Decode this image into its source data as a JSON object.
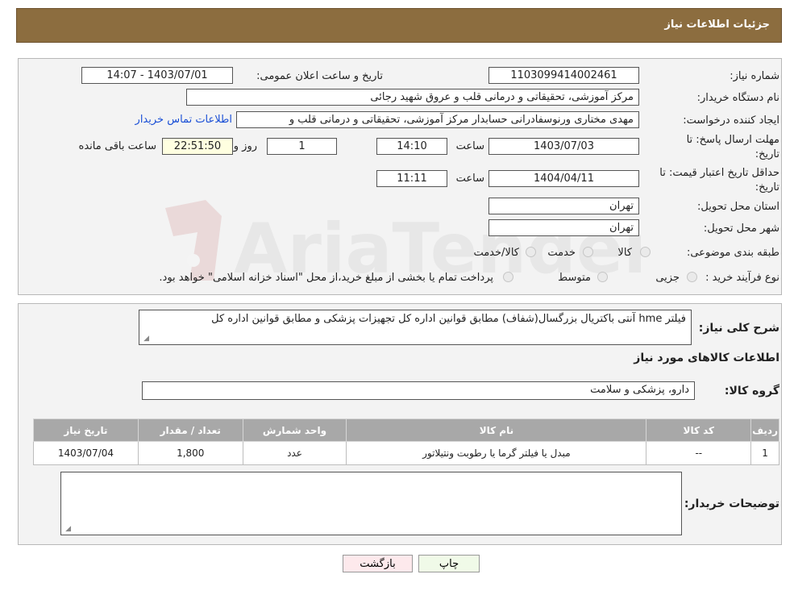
{
  "header": {
    "title": "جزئیات اطلاعات نیاز"
  },
  "need": {
    "number_label": "شماره نیاز:",
    "number_value": "1103099414002461",
    "announce_label": "تاریخ و ساعت اعلان عمومی:",
    "announce_value": "1403/07/01 - 14:07",
    "buyer_label": "نام دستگاه خریدار:",
    "buyer_value": "مرکز آموزشی، تحقیقاتی و درمانی قلب و عروق شهید رجائی",
    "creator_label": "ایجاد کننده درخواست:",
    "creator_value": "مهدی مختاری ورنوسفادرانی حسابدار مرکز آموزشی، تحقیقاتی و درمانی قلب و",
    "contact_link": "اطلاعات تماس خریدار",
    "deadline_label_1": "مهلت ارسال پاسخ: تا",
    "deadline_label_2": "تاریخ:",
    "deadline_date": "1403/07/03",
    "time_label": "ساعت",
    "deadline_time": "14:10",
    "days_value": "1",
    "days_label": "روز و",
    "remaining_value": "22:51:50",
    "remaining_label": "ساعت باقی مانده",
    "validity_label_1": "حداقل تاریخ اعتبار قیمت: تا",
    "validity_label_2": "تاریخ:",
    "validity_date": "1404/04/11",
    "validity_time": "11:11",
    "province_label": "استان محل تحویل:",
    "province_value": "تهران",
    "city_label": "شهر محل تحویل:",
    "city_value": "تهران",
    "category_label": "طبقه بندی موضوعی:",
    "category_options": [
      "کالا",
      "خدمت",
      "کالا/خدمت"
    ],
    "process_label": "نوع فرآیند خرید :",
    "process_options": [
      "جزیی",
      "متوسط"
    ],
    "process_note": "پرداخت تمام یا بخشی از مبلغ خرید،از محل \"اسناد خزانه اسلامی\" خواهد بود."
  },
  "details": {
    "summary_label": "شرح کلی نیاز:",
    "summary_value": "فیلتر hme آنتی باکتریال بزرگسال(شفاف) مطابق قوانین اداره کل تجهیزات پزشکی و مطابق قوانین اداره کل",
    "goods_info_title": "اطلاعات کالاهای مورد نیاز",
    "group_label": "گروه کالا:",
    "group_value": "دارو، پزشکی و سلامت",
    "table": {
      "headers": [
        "ردیف",
        "کد کالا",
        "نام کالا",
        "واحد شمارش",
        "تعداد / مقدار",
        "تاریخ نیاز"
      ],
      "rows": [
        [
          "1",
          "--",
          "مبدل یا فیلتر گرما یا رطوبت ونتیلاتور",
          "عدد",
          "1,800",
          "1403/07/04"
        ]
      ]
    },
    "buyer_notes_label": "توضیحات خریدار:",
    "buyer_notes_value": ""
  },
  "buttons": {
    "print": "چاپ",
    "back": "بازگشت"
  },
  "watermark": {
    "text": "AriaTender.neT"
  }
}
